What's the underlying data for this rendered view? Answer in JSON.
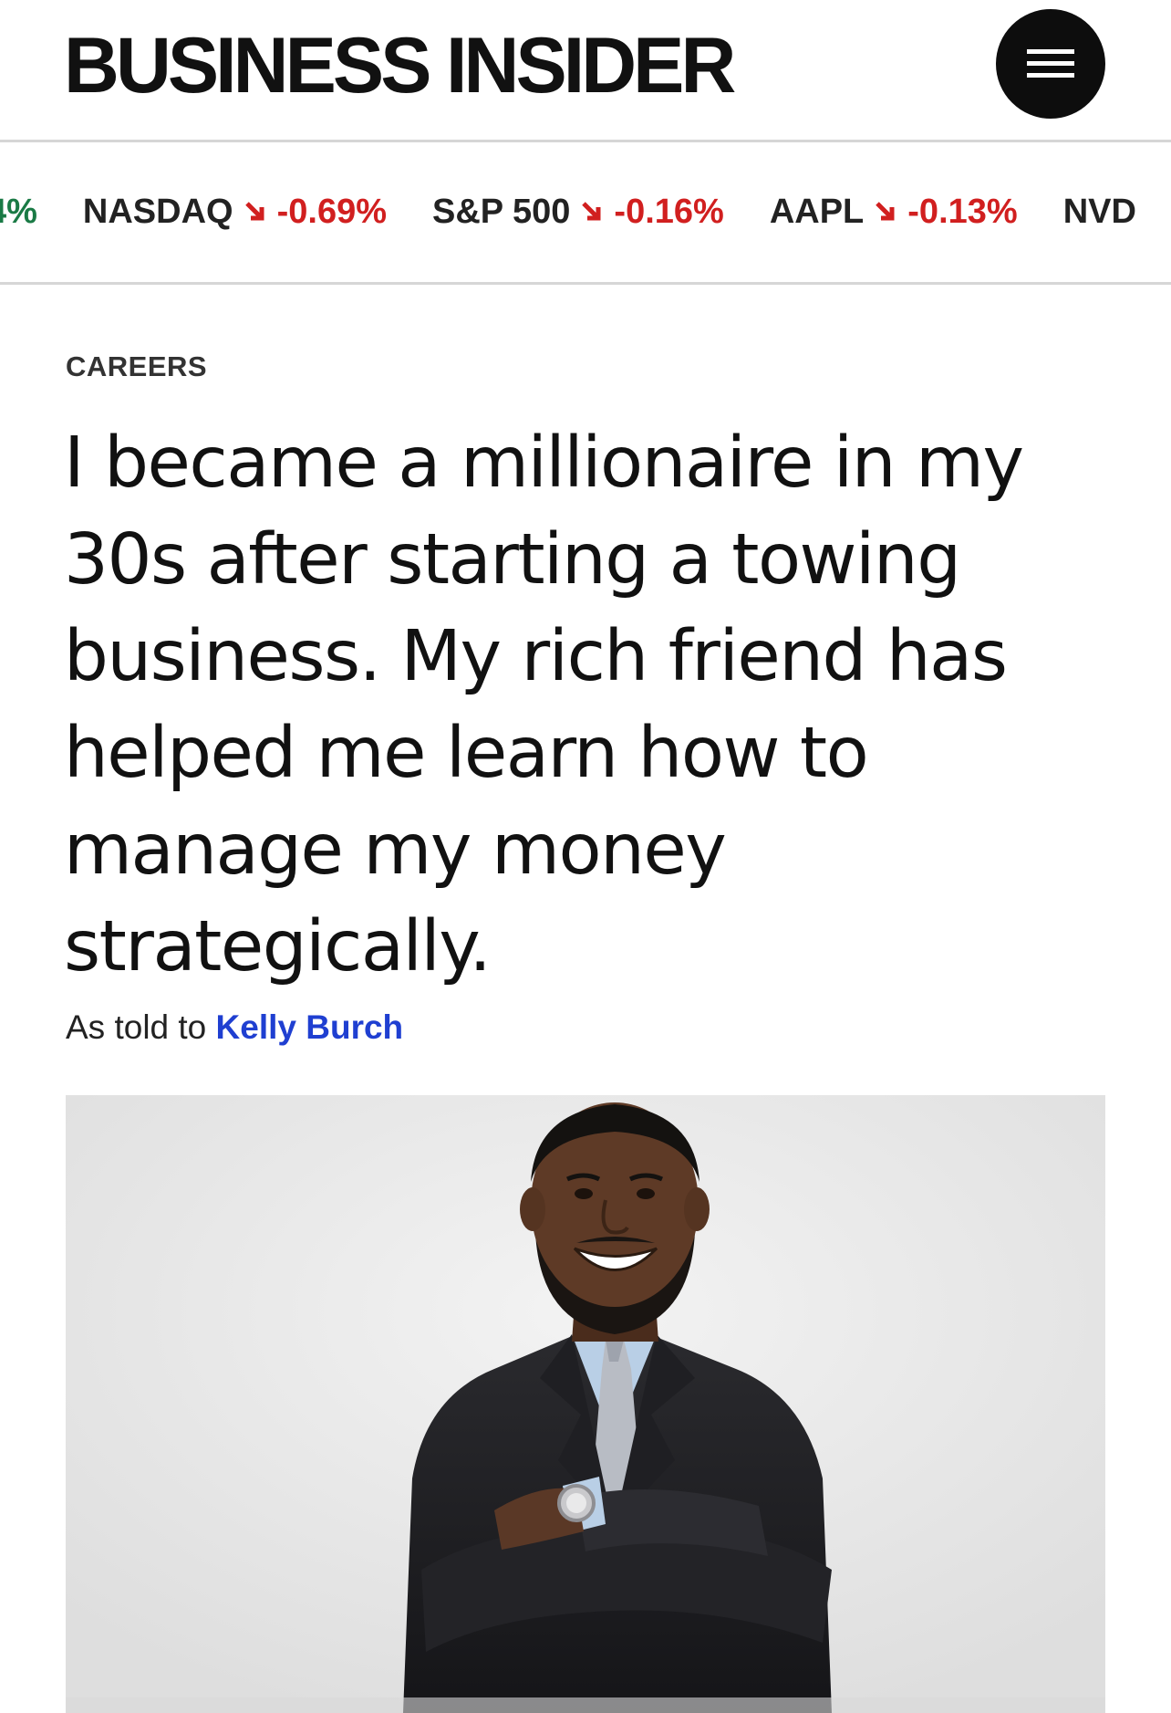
{
  "header": {
    "logo_text": "BUSINESS INSIDER",
    "menu_icon": "hamburger-menu-icon"
  },
  "ticker": {
    "items": [
      {
        "symbol": "",
        "change": "4%",
        "direction": "up"
      },
      {
        "symbol": "NASDAQ",
        "change": "-0.69%",
        "direction": "down"
      },
      {
        "symbol": "S&P 500",
        "change": "-0.16%",
        "direction": "down"
      },
      {
        "symbol": "AAPL",
        "change": "-0.13%",
        "direction": "down"
      },
      {
        "symbol": "NVD",
        "change": "",
        "direction": "down"
      }
    ],
    "colors": {
      "down": "#d11f1f",
      "up": "#1a7a45"
    }
  },
  "article": {
    "category": "CAREERS",
    "headline": "I became a millionaire in my 30s after starting a towing business. My rich friend has helped me learn how to manage my money strategically.",
    "byline_prefix": "As told to",
    "author": "Kelly Burch",
    "hero_image": "portrait-of-smiling-man-in-suit-with-arms-crossed"
  },
  "colors": {
    "author_link": "#1f3fd1",
    "text": "#111111",
    "divider": "#d6d6d6"
  }
}
